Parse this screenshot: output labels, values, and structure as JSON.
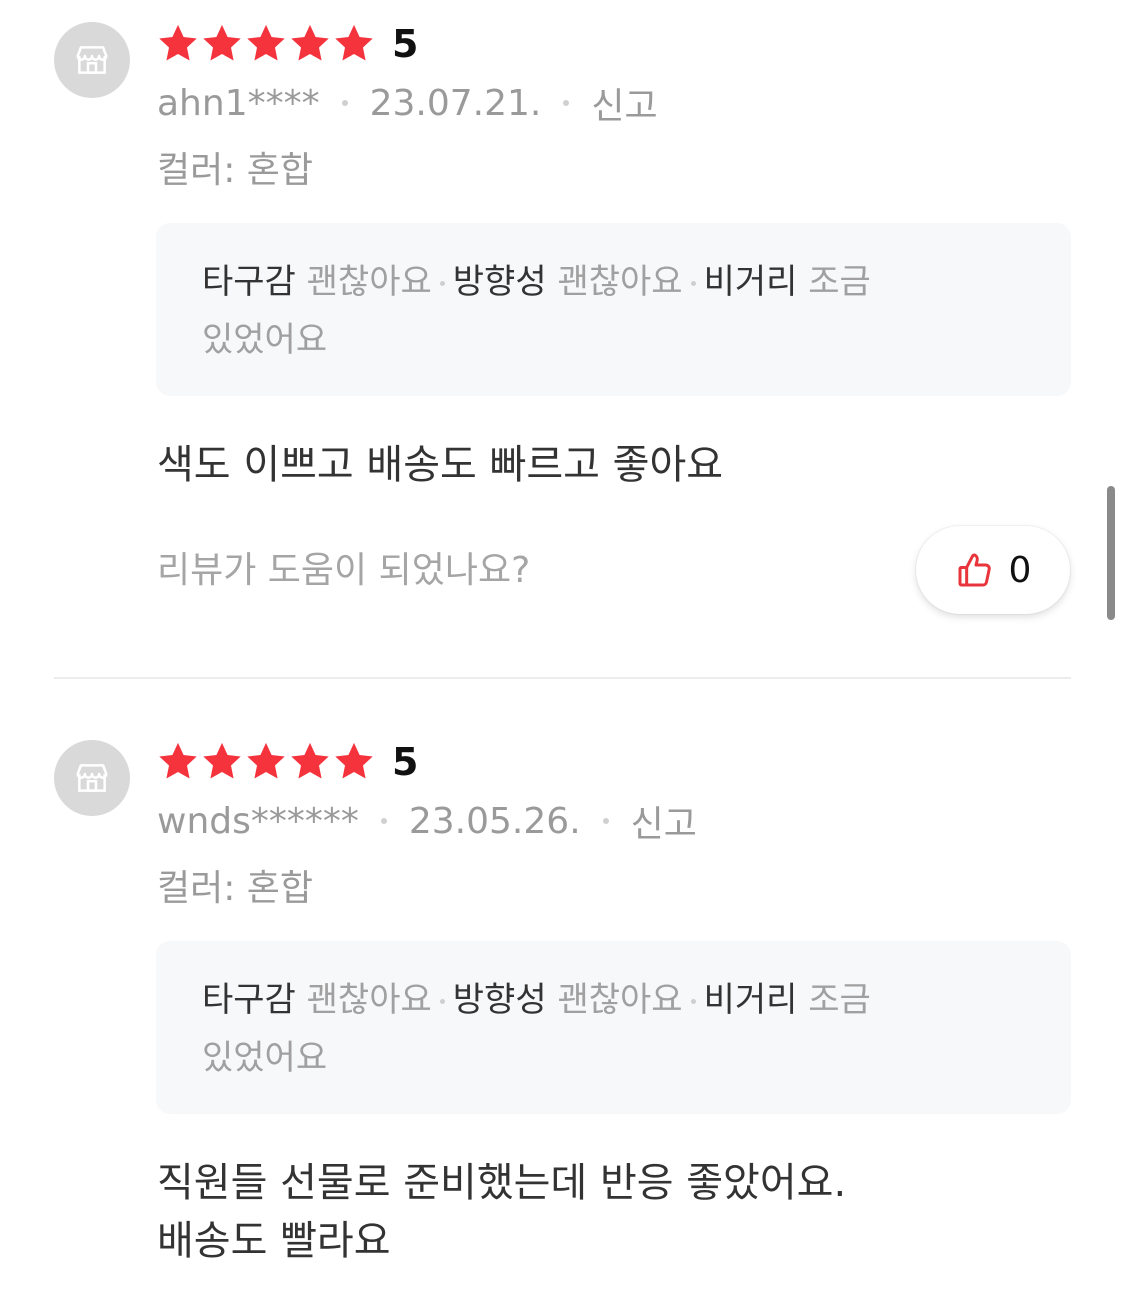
{
  "colors": {
    "star": "#f4333d",
    "like_icon": "#e8343a",
    "muted": "#9a9a9a",
    "survey_bg": "#f7f8fa"
  },
  "reviews": [
    {
      "rating": 5,
      "score": "5",
      "user": "ahn1****",
      "date": "23.07.21.",
      "report": "신고",
      "option": "컬러: 혼합",
      "survey": {
        "k1": "타구감",
        "v1": "괜찮아요",
        "k2": "방향성",
        "v2": "괜찮아요",
        "k3": "비거리",
        "v3": "조금",
        "v3_cont": "있었어요"
      },
      "text": "색도 이쁘고 배송도 빠르고  좋아요",
      "helpful_prompt": "리뷰가 도움이 되었나요?",
      "like_count": "0"
    },
    {
      "rating": 5,
      "score": "5",
      "user": "wnds******",
      "date": "23.05.26.",
      "report": "신고",
      "option": "컬러: 혼합",
      "survey": {
        "k1": "타구감",
        "v1": "괜찮아요",
        "k2": "방향성",
        "v2": "괜찮아요",
        "k3": "비거리",
        "v3": "조금",
        "v3_cont": "있었어요"
      },
      "text": "직원들 선물로 준비했는데 반응 좋았어요.\n배송도 빨라요"
    }
  ]
}
